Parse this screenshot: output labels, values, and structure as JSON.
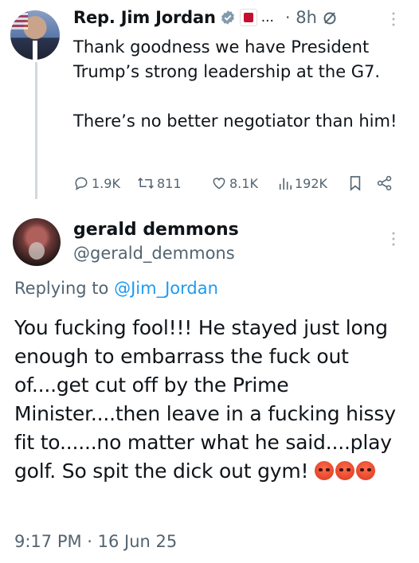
{
  "tweet1": {
    "author_name": "Rep. Jim Jordan",
    "name_ellipsis": "...",
    "time": "· 8h",
    "text": "Thank goodness we have President Trump’s strong leadership at the G7.\n\nThere’s no better negotiator than him!",
    "actions": {
      "replies": "1.9K",
      "retweets": "811",
      "likes": "8.1K",
      "views": "192K"
    }
  },
  "tweet2": {
    "author_name": "gerald demmons",
    "handle": "@gerald_demmons",
    "replying_prefix": "Replying to ",
    "replying_to": "@Jim_Jordan",
    "text": "You fucking fool!!!  He stayed just long enough to embarrass the fuck out of....get cut off by the Prime Minister....then leave in a fucking hissy fit to......no matter what he said....play golf. So spit the dick out gym! ",
    "emojis": [
      "pouting-face",
      "pouting-face",
      "pouting-face"
    ],
    "timestamp": "9:17 PM · 16 Jun 25"
  },
  "colors": {
    "secondary_text": "#536471",
    "link": "#1d9bf0",
    "verified": "#829aab",
    "thread_line": "#cfd9de",
    "gov_badge": "#c4102e"
  }
}
